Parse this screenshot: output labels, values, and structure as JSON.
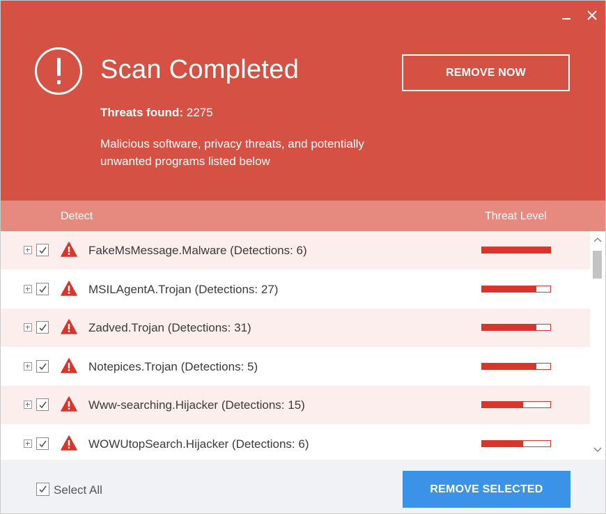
{
  "colors": {
    "header_bg": "#d45144",
    "column_header_bg": "#e68a7f",
    "alt_row_bg": "#fbeeec",
    "threat_red": "#d9362b",
    "primary_button": "#3b93e8",
    "footer_bg": "#f0f2f6"
  },
  "window": {
    "minimize_icon": "minimize-icon",
    "close_icon": "close-icon"
  },
  "header": {
    "icon": "exclamation-circle-icon",
    "title": "Scan Completed",
    "threats_label": "Threats found:",
    "threats_count": "2275",
    "description": "Malicious software, privacy threats, and potentially unwanted programs listed below",
    "remove_now_label": "REMOVE NOW"
  },
  "columns": {
    "detect": "Detect",
    "threat_level": "Threat Level"
  },
  "threats": [
    {
      "name": "FakeMsMessage.Malware (Detections: 6)",
      "checked": true,
      "threat_level": 1.0
    },
    {
      "name": "MSILAgentA.Trojan (Detections: 27)",
      "checked": true,
      "threat_level": 0.8
    },
    {
      "name": "Zadved.Trojan (Detections: 31)",
      "checked": true,
      "threat_level": 0.8
    },
    {
      "name": "Notepices.Trojan (Detections: 5)",
      "checked": true,
      "threat_level": 0.8
    },
    {
      "name": "Www-searching.Hijacker (Detections: 15)",
      "checked": true,
      "threat_level": 0.6
    },
    {
      "name": "WOWUtopSearch.Hijacker (Detections: 6)",
      "checked": true,
      "threat_level": 0.6
    }
  ],
  "footer": {
    "select_all_label": "Select All",
    "select_all_checked": true,
    "remove_selected_label": "REMOVE SELECTED"
  }
}
